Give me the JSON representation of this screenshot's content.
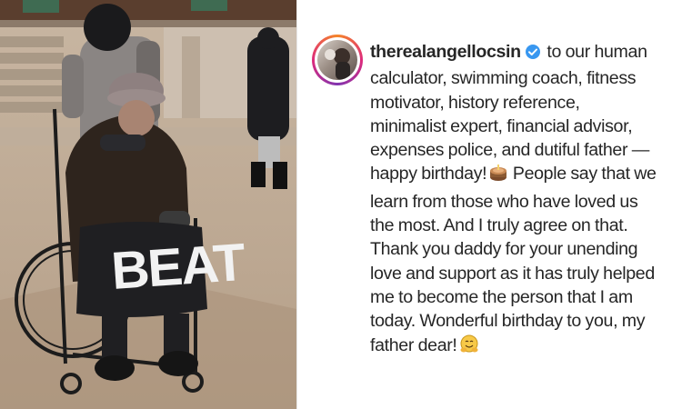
{
  "post": {
    "username": "therealangellocsin",
    "caption_lines": [
      "to our human",
      "calculator, swimming coach, fitness",
      "motivator, history reference,",
      "minimalist expert, financial advisor,",
      "expenses police, and dutiful father —",
      "happy birthday!",
      "People say that we",
      "learn from those who have loved us",
      "the most. And I truly agree on that.",
      "Thank you daddy for your unending",
      "love and support as it has truly helped",
      "me to become the person that I am",
      "today. Wonderful birthday to you, my",
      "father dear!"
    ],
    "emojis": [
      "cake-emoji",
      "hugging-face-emoji"
    ]
  },
  "photo": {
    "blanket_text": "BEAT"
  },
  "colors": {
    "text": "#262626",
    "verified": "#3897f0",
    "story_ring": [
      "#f58529",
      "#dd2a7b",
      "#8134af"
    ]
  }
}
